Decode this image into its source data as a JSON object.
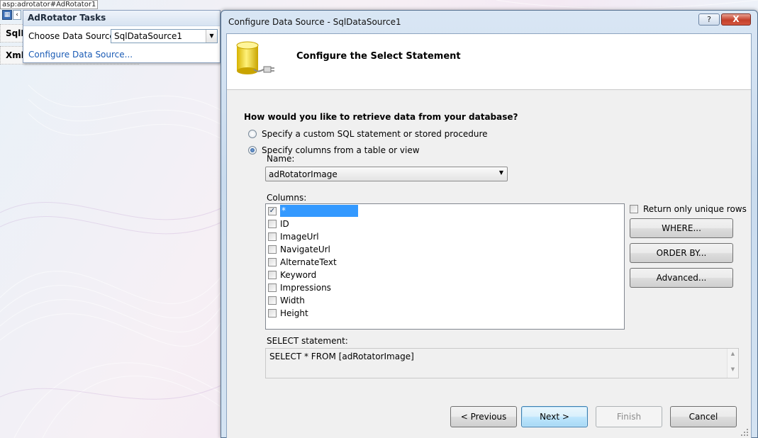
{
  "designer": {
    "control_tag": "asp:adrotator#AdRotator1",
    "row1_label": "SqlD",
    "row2_label": "Xml"
  },
  "tasks_panel": {
    "title": "AdRotator Tasks",
    "choose_label": "Choose Data Source:",
    "data_source_value": "SqlDataSource1",
    "configure_link": "Configure Data Source..."
  },
  "dialog": {
    "title": "Configure Data Source - SqlDataSource1",
    "help_label": "?",
    "close_label": "X",
    "banner_title": "Configure the Select Statement",
    "question": "How would you like to retrieve data from your database?",
    "options": [
      {
        "label": "Specify a custom SQL statement or stored procedure",
        "selected": false
      },
      {
        "label": "Specify columns from a table or view",
        "selected": true
      }
    ],
    "name_label": "Name:",
    "name_value": "adRotatorImage",
    "columns_label": "Columns:",
    "columns": [
      {
        "label": "*",
        "checked": true
      },
      {
        "label": "ID",
        "checked": false
      },
      {
        "label": "ImageUrl",
        "checked": false
      },
      {
        "label": "NavigateUrl",
        "checked": false
      },
      {
        "label": "AlternateText",
        "checked": false
      },
      {
        "label": "Keyword",
        "checked": false
      },
      {
        "label": "Impressions",
        "checked": false
      },
      {
        "label": "Width",
        "checked": false
      },
      {
        "label": "Height",
        "checked": false
      }
    ],
    "unique_rows_label": "Return only unique rows",
    "where_label": "WHERE...",
    "order_by_label": "ORDER BY...",
    "advanced_label": "Advanced...",
    "select_label": "SELECT statement:",
    "select_text": "SELECT * FROM [adRotatorImage]",
    "buttons": {
      "previous": "< Previous",
      "next": "Next >",
      "finish": "Finish",
      "cancel": "Cancel"
    }
  }
}
